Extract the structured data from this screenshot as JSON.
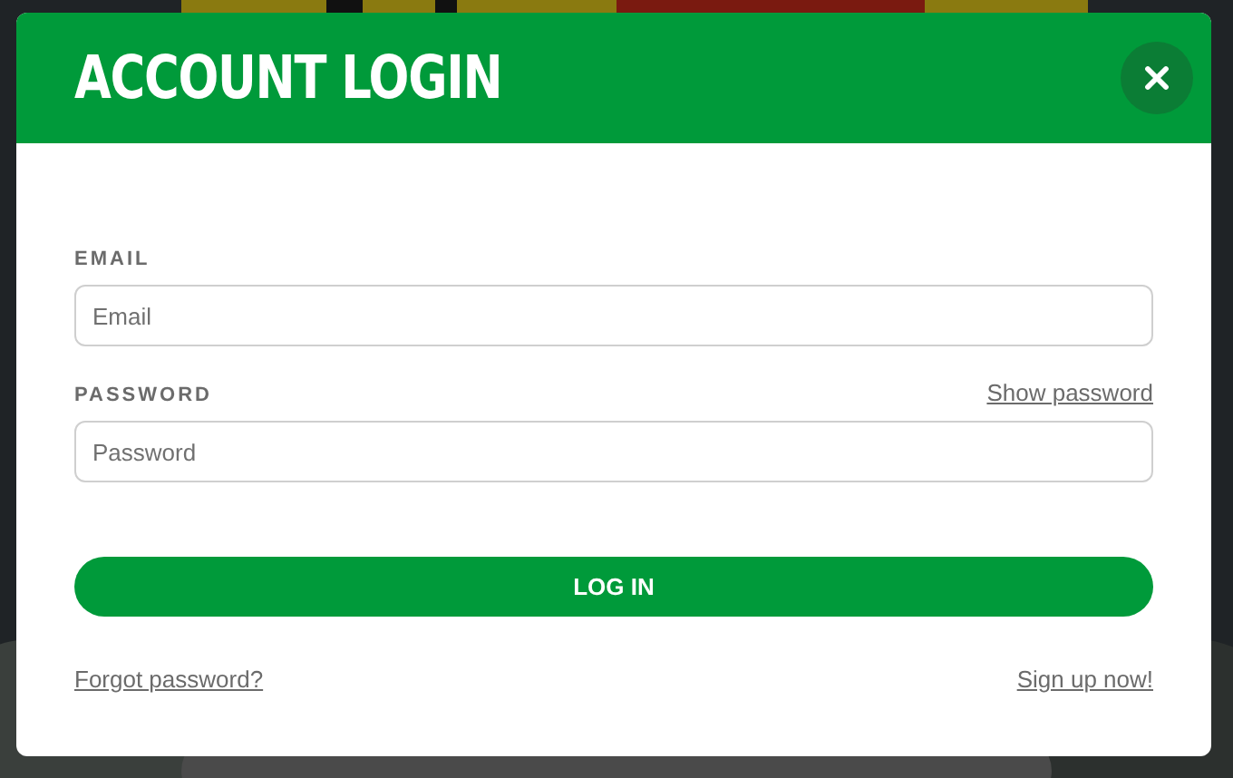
{
  "dialog": {
    "title": "ACCOUNT LOGIN"
  },
  "fields": [
    {
      "label": "EMAIL",
      "placeholder": "Email"
    },
    {
      "label": "PASSWORD",
      "placeholder": "Password",
      "action": "Show password"
    }
  ],
  "login_button": "LOG IN",
  "links": [
    "Forgot password?",
    "Sign up now!"
  ]
}
